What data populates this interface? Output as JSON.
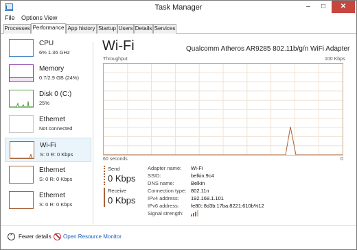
{
  "window": {
    "title": "Task Manager",
    "minimize_glyph": "‒",
    "maximize_glyph": "□",
    "close_glyph": "✕"
  },
  "menu": [
    "File",
    "Options",
    "View"
  ],
  "tabs": [
    "Processes",
    "Performance",
    "App history",
    "Startup",
    "Users",
    "Details",
    "Services"
  ],
  "active_tab": "Performance",
  "sidebar": {
    "items": [
      {
        "name": "CPU",
        "sub": "6% 1.36 GHz",
        "color": "#4a8ac5"
      },
      {
        "name": "Memory",
        "sub": "0.7/2.9 GB (24%)",
        "color": "#8b3aa8"
      },
      {
        "name": "Disk 0 (C:)",
        "sub": "25%",
        "color": "#4d9a3a"
      },
      {
        "name": "Ethernet",
        "sub": "Not connected",
        "color": "#c9c9c9"
      },
      {
        "name": "Wi-Fi",
        "sub": "S: 0 R: 0 Kbps",
        "color": "#a8643a"
      },
      {
        "name": "Ethernet",
        "sub": "S: 0 R: 0 Kbps",
        "color": "#a8643a"
      },
      {
        "name": "Ethernet",
        "sub": "S: 0 R: 0 Kbps",
        "color": "#a8643a"
      }
    ],
    "selected_index": 4
  },
  "main": {
    "title": "Wi-Fi",
    "adapter": "Qualcomm Atheros AR9285 802.11b/g/n WiFi Adapter",
    "graph_label": "Throughput",
    "graph_max": "100 Kbps",
    "graph_time": "60 seconds",
    "graph_min": "0",
    "graph_color": "#a8643a"
  },
  "send": {
    "label": "Send",
    "value": "0 Kbps"
  },
  "receive": {
    "label": "Receive",
    "value": "0 Kbps"
  },
  "details": [
    {
      "key": "Adapter name:",
      "value": "Wi-Fi"
    },
    {
      "key": "SSID:",
      "value": "belkin.9c4"
    },
    {
      "key": "DNS name:",
      "value": "Belkin"
    },
    {
      "key": "Connection type:",
      "value": "802.11n"
    },
    {
      "key": "IPv4 address:",
      "value": "192.168.1.101"
    },
    {
      "key": "IPv6 address:",
      "value": "fe80::8d3b:17ba:8221:610b%12"
    },
    {
      "key": "Signal strength:",
      "value": ""
    }
  ],
  "footer": {
    "fewer_details": "Fewer details",
    "open_monitor": "Open Resource Monitor"
  }
}
